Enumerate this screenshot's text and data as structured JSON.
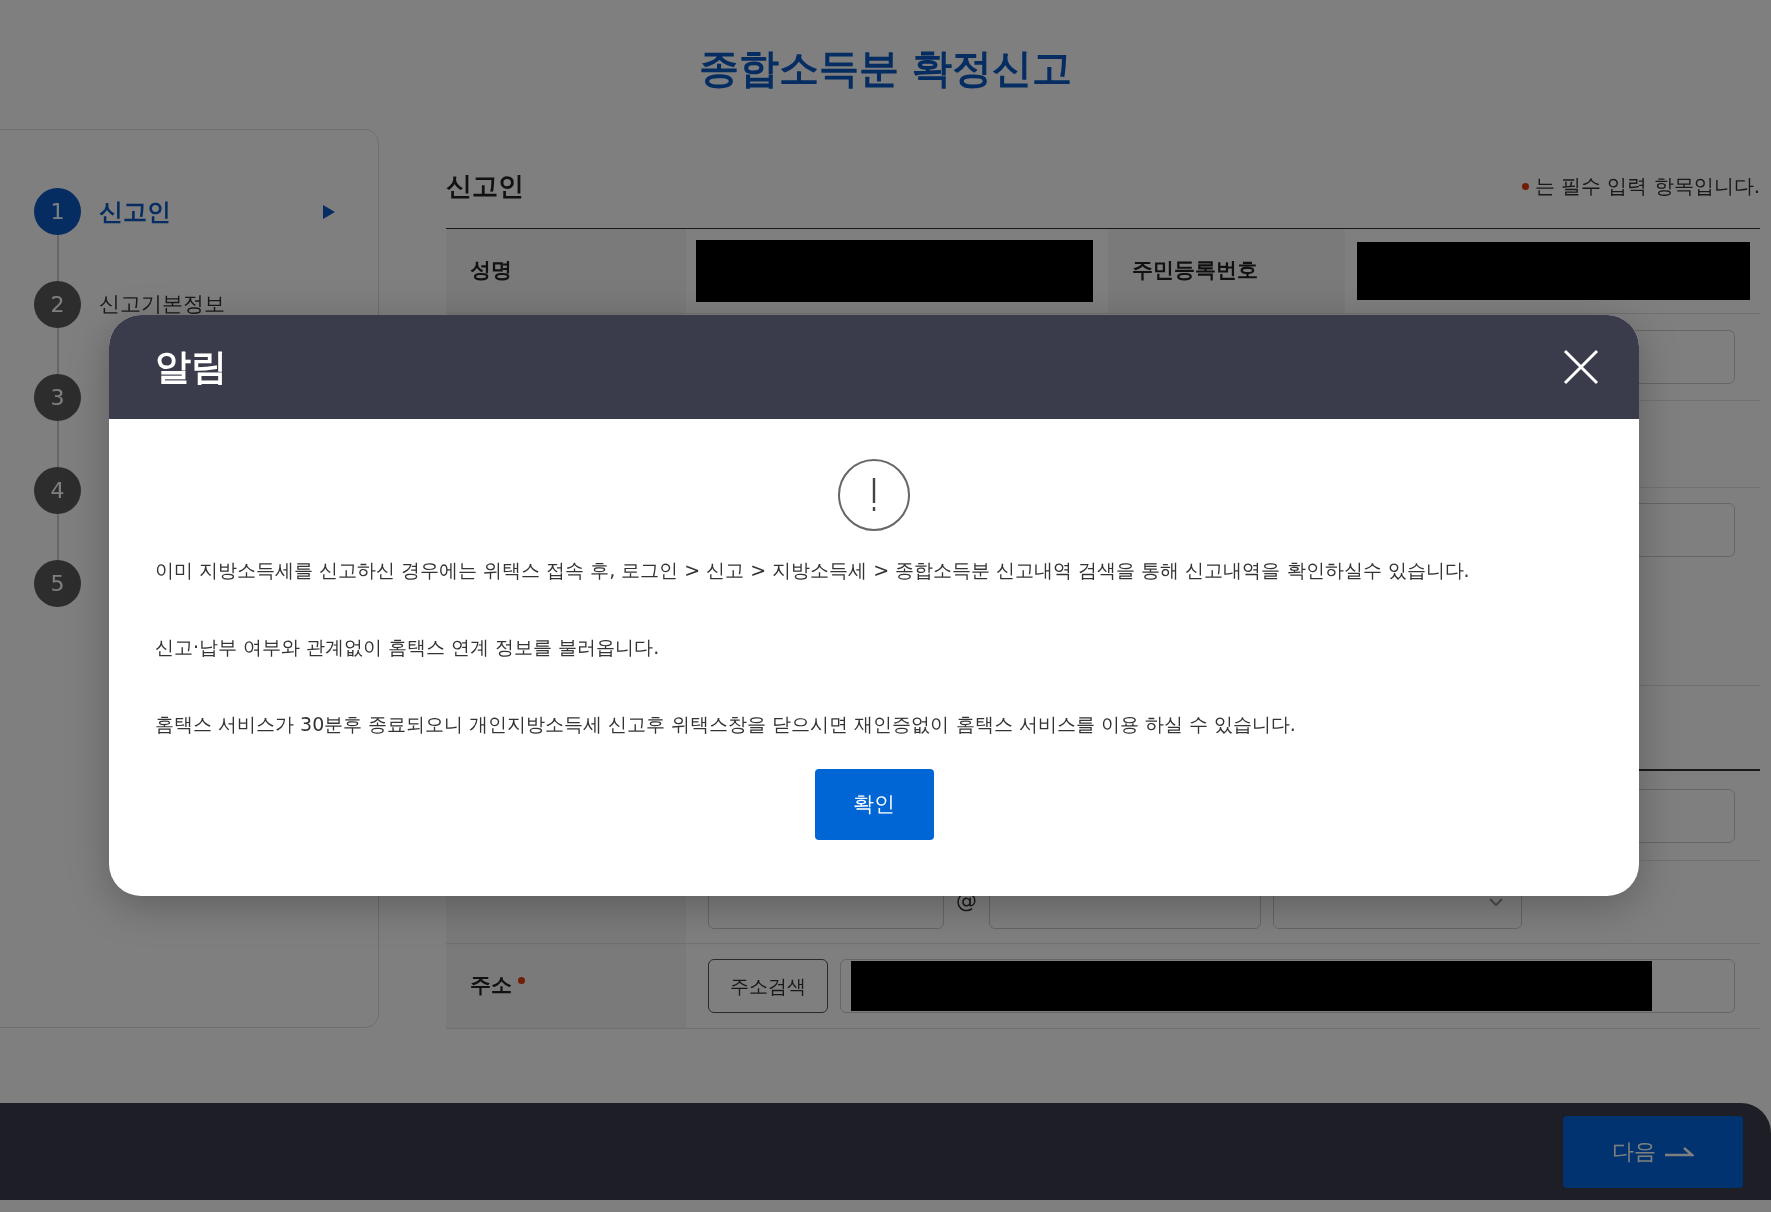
{
  "page_title": "종합소득분 확정신고",
  "steps": [
    {
      "number": "1",
      "label": "신고인",
      "selected": true
    },
    {
      "number": "2",
      "label": "신고기본정보",
      "selected": false
    },
    {
      "number": "3",
      "selected": false
    },
    {
      "number": "4",
      "selected": false
    },
    {
      "number": "5",
      "selected": false
    }
  ],
  "section": {
    "title": "신고인",
    "required_note": "는 필수 입력 항목입니다."
  },
  "form": {
    "name_label": "성명",
    "id_label": "주민등록번호",
    "email": {
      "at": "@"
    },
    "address": {
      "label": "주소",
      "required": true,
      "search_button": "주소검색"
    }
  },
  "modal": {
    "title": "알림",
    "messages": [
      "이미 지방소득세를 신고하신 경우에는 위택스 접속 후, 로그인 > 신고 > 지방소득세 > 종합소득분 신고내역 검색을 통해 신고내역을 확인하실수 있습니다.",
      "신고·납부 여부와 관계없이 홈택스 연계 정보를 불러옵니다.",
      "홈택스 서비스가 30분후 종료되오니 개인지방소득세 신고후 위택스창을 닫으시면 재인증없이 홈택스 서비스를 이용 하실 수 있습니다."
    ],
    "confirm_button": "확인"
  },
  "footer": {
    "next_button": "다음"
  }
}
